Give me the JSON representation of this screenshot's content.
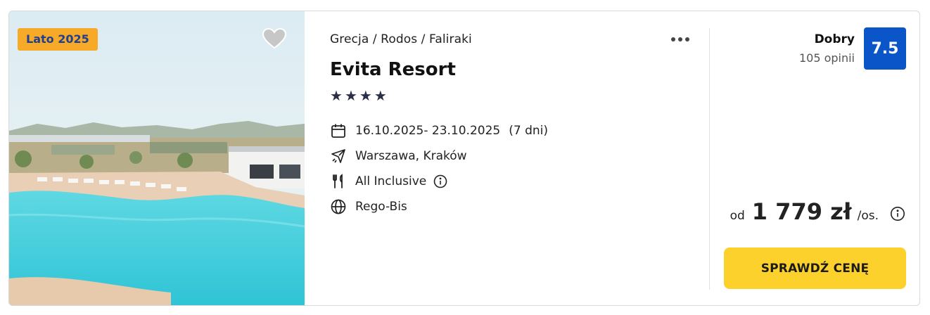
{
  "offer": {
    "season_badge": "Lato 2025",
    "breadcrumb": "Grecja / Rodos / Faliraki",
    "hotel_name": "Evita Resort",
    "stars": 4,
    "dates": "16.10.2025- 23.10.2025",
    "duration": "(7 dni)",
    "departure": "Warszawa, Kraków",
    "board": "All Inclusive",
    "operator": "Rego-Bis"
  },
  "rating": {
    "label": "Dobry",
    "count": "105 opinii",
    "score": "7.5"
  },
  "price": {
    "prefix": "od",
    "amount": "1 779 zł",
    "suffix": "/os."
  },
  "cta_label": "SPRAWDŹ CENĘ",
  "colors": {
    "badge_bg": "#f7a928",
    "badge_text": "#1f3f8f",
    "score_bg": "#0a55c7",
    "cta_bg": "#fdd12b"
  },
  "icons": {
    "favorite": "heart-icon",
    "more": "more-dots-icon",
    "dates": "calendar-icon",
    "departure": "plane-icon",
    "board": "cutlery-icon",
    "operator": "globe-icon",
    "info": "info-icon"
  }
}
